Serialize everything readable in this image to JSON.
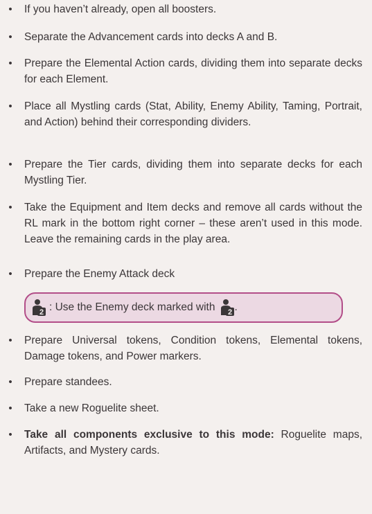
{
  "steps": [
    {
      "text": "If you haven’t already, open all boosters."
    },
    {
      "text": "Separate the Advancement cards into decks A and B."
    },
    {
      "text": "Prepare the Elemental Action cards, dividing them into separate decks for each Element."
    },
    {
      "text": "Place all Mystling cards (Stat, Ability, Enemy Ability, Taming, Portrait, and Action) behind their corresponding dividers."
    },
    {
      "text": "Prepare the Tier cards, dividing them into separate decks for each Mystling Tier."
    },
    {
      "text": "Take the Equipment and Item decks and remove all cards without the RL mark in the bottom right corner – these aren’t used in this mode. Leave the remaining cards in the play area."
    },
    {
      "text": "Prepare the Enemy Attack deck"
    },
    {
      "text": "Prepare Universal tokens, Condition tokens, Elemental tokens, Damage tokens, and Power markers."
    },
    {
      "text": "Prepare standees."
    },
    {
      "text": "Take a new Roguelite sheet."
    },
    {
      "bold": "Take all components exclusive to this mode:",
      "text": " Roguelite maps, Artifacts, and Mystery cards."
    }
  ],
  "callout": {
    "prefix": ": Use the Enemy deck marked with",
    "suffix": ".",
    "icon": "two-player-icon",
    "border_color": "#b24d88",
    "fill_color": "#ecd9e3"
  },
  "bullet": "•"
}
